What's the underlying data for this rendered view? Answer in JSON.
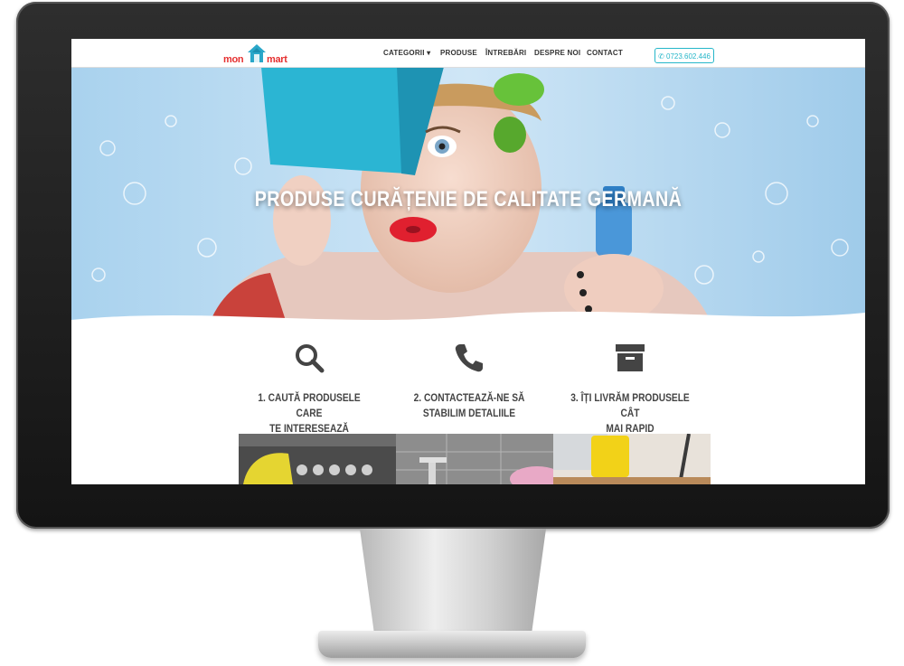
{
  "logo": {
    "left": "mon",
    "right": "mart"
  },
  "nav": {
    "items": [
      "CATEGORII",
      "PRODUSE",
      "ÎNTREBĂRI",
      "DESPRE NOI",
      "CONTACT"
    ],
    "phone": "0723.602.446"
  },
  "hero": {
    "title": "PRODUSE CURĂȚENIE DE CALITATE GERMANĂ"
  },
  "steps": [
    {
      "line1": "1. CAUTĂ PRODUSELE CARE",
      "line2": "TE INTERESEAZĂ",
      "icon": "search-icon"
    },
    {
      "line1": "2. CONTACTEAZĂ-NE SĂ",
      "line2": "STABILIM DETALIILE",
      "icon": "phone-icon"
    },
    {
      "line1": "3. ÎȚI LIVRĂM PRODUSELE CÂT",
      "line2": "MAI RAPID",
      "icon": "archive-box-icon"
    }
  ],
  "colors": {
    "accent": "#25b6c9",
    "brand": "#e53030"
  }
}
